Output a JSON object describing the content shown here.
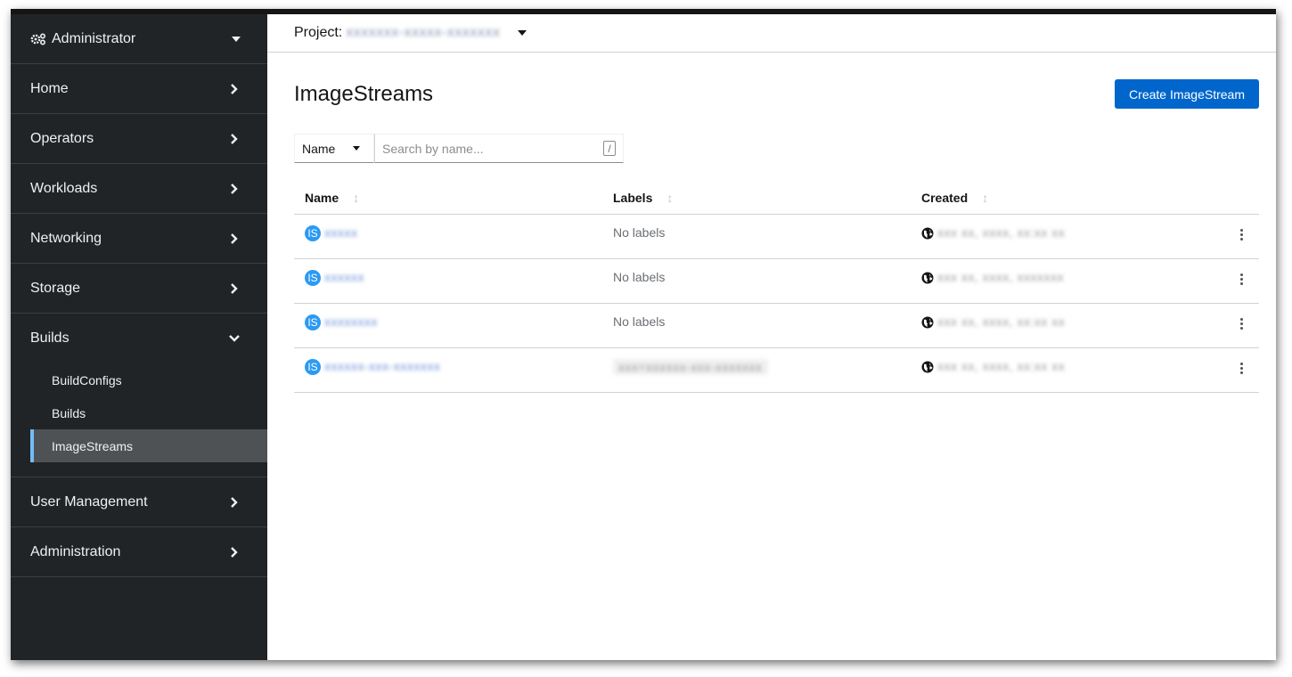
{
  "sidebar": {
    "perspective": {
      "label": "Administrator",
      "icon": "cogs-icon"
    },
    "sections": [
      {
        "label": "Home",
        "expanded": false
      },
      {
        "label": "Operators",
        "expanded": false
      },
      {
        "label": "Workloads",
        "expanded": false
      },
      {
        "label": "Networking",
        "expanded": false
      },
      {
        "label": "Storage",
        "expanded": false
      }
    ],
    "builds": {
      "label": "Builds",
      "expanded": true,
      "items": [
        {
          "label": "BuildConfigs",
          "active": false
        },
        {
          "label": "Builds",
          "active": false
        },
        {
          "label": "ImageStreams",
          "active": true
        }
      ]
    },
    "sections_after": [
      {
        "label": "User Management",
        "expanded": false
      },
      {
        "label": "Administration",
        "expanded": false
      }
    ]
  },
  "project_bar": {
    "label": "Project:",
    "value_redacted": "xxxxxxx-xxxxx-xxxxxxx"
  },
  "page": {
    "title": "ImageStreams",
    "create_button": "Create ImageStream"
  },
  "filter": {
    "type_selected": "Name",
    "search_placeholder": "Search by name...",
    "shortcut_hint": "/"
  },
  "table": {
    "columns": [
      "Name",
      "Labels",
      "Created"
    ],
    "rows": [
      {
        "badge": "IS",
        "name_redacted": "xxxxx",
        "labels": "No labels",
        "labels_redacted": false,
        "created_redacted": "xxx xx, xxxx, xx:xx xx"
      },
      {
        "badge": "IS",
        "name_redacted": "xxxxxx",
        "labels": "No labels",
        "labels_redacted": false,
        "created_redacted": "xxx xx, xxxx, xxxxxxx"
      },
      {
        "badge": "IS",
        "name_redacted": "xxxxxxxx",
        "labels": "No labels",
        "labels_redacted": false,
        "created_redacted": "xxx xx, xxxx, xx:xx xx"
      },
      {
        "badge": "IS",
        "name_redacted": "xxxxxx-xxx-xxxxxxx",
        "labels": "xxx=xxxxxx-xxx-xxxxxxx",
        "labels_redacted": true,
        "created_redacted": "xxx xx, xxxx, xx:xx xx"
      }
    ]
  },
  "colors": {
    "sidebar_bg": "#212427",
    "active_item_bg": "#4f5255",
    "active_accent": "#73bcf7",
    "primary_button": "#0066cc",
    "badge": "#2b9af3"
  }
}
